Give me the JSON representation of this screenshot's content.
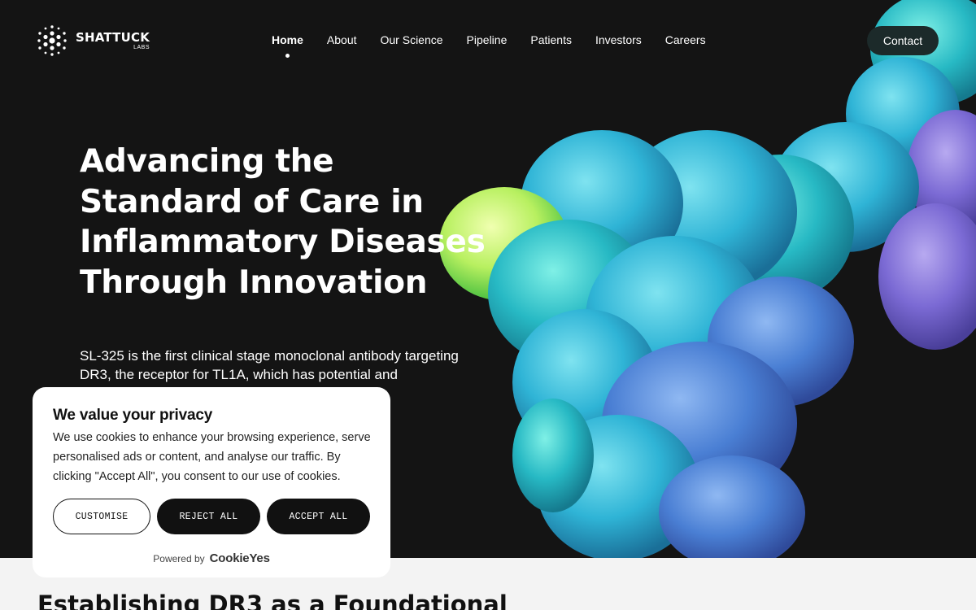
{
  "brand": {
    "name": "SHATTUCK",
    "sub": "LABS"
  },
  "nav": {
    "items": [
      {
        "label": "Home"
      },
      {
        "label": "About"
      },
      {
        "label": "Our Science"
      },
      {
        "label": "Pipeline"
      },
      {
        "label": "Patients"
      },
      {
        "label": "Investors"
      },
      {
        "label": "Careers"
      }
    ],
    "contact_label": "Contact"
  },
  "hero": {
    "title": "Advancing the Standard of Care in Inflammatory Diseases Through Innovation",
    "description": "SL-325 is the first clinical stage monoclonal antibody targeting DR3, the receptor for TL1A, which has potential and"
  },
  "section2": {
    "title": "Establishing DR3 as a Foundational"
  },
  "cookie": {
    "title": "We value your privacy",
    "text": "We use cookies to enhance your browsing experience, serve personalised ads or content, and analyse our traffic. By clicking \"Accept All\", you consent to our use of cookies.",
    "customise_label": "CUSTOMISE",
    "reject_label": "REJECT ALL",
    "accept_label": "ACCEPT ALL",
    "powered_by": "Powered by",
    "powered_logo": "CookieYes"
  },
  "colors": {
    "hero_bg": "#141414",
    "contact_bg": "#1c2a2a",
    "button_dark": "#111111"
  }
}
